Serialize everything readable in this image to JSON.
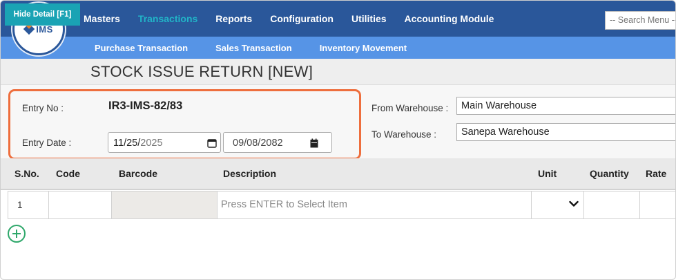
{
  "logo": {
    "text": "IMS"
  },
  "nav": {
    "items": [
      {
        "label": "Masters",
        "active": false
      },
      {
        "label": "Transactions",
        "active": true
      },
      {
        "label": "Reports",
        "active": false
      },
      {
        "label": "Configuration",
        "active": false
      },
      {
        "label": "Utilities",
        "active": false
      },
      {
        "label": "Accounting Module",
        "active": false
      }
    ],
    "search_placeholder": "-- Search Menu --"
  },
  "subnav": {
    "items": [
      "Purchase Transaction",
      "Sales Transaction",
      "Inventory Movement"
    ]
  },
  "toolbar": {
    "hide_detail_label": "Hide Detail [F1]",
    "page_title": "STOCK ISSUE RETURN [NEW]"
  },
  "form": {
    "entry_no_label": "Entry No :",
    "entry_no_value": "IR3-IMS-82/83",
    "entry_date_label": "Entry Date :",
    "entry_date_ad_month": "11",
    "entry_date_ad_day": "25",
    "entry_date_ad_year": "2025",
    "entry_date_bs": "09/08/2082",
    "from_warehouse_label": "From Warehouse :",
    "from_warehouse_value": "Main Warehouse",
    "to_warehouse_label": "To Warehouse :",
    "to_warehouse_value": "Sanepa Warehouse"
  },
  "table": {
    "headers": [
      "S.No.",
      "Code",
      "Barcode",
      "Description",
      "Unit",
      "Quantity",
      "Rate"
    ],
    "rows": [
      {
        "sno": "1",
        "code": "",
        "barcode": "",
        "description_placeholder": "Press ENTER to Select Item",
        "unit": "",
        "quantity": "",
        "rate": ""
      }
    ]
  },
  "colors": {
    "nav_bg": "#2a579a",
    "subnav_bg": "#5694e6",
    "active_nav": "#21b5c8",
    "button_teal": "#1aa3b4",
    "highlight_orange": "#ee6e3d",
    "add_green": "#2fa86b"
  }
}
